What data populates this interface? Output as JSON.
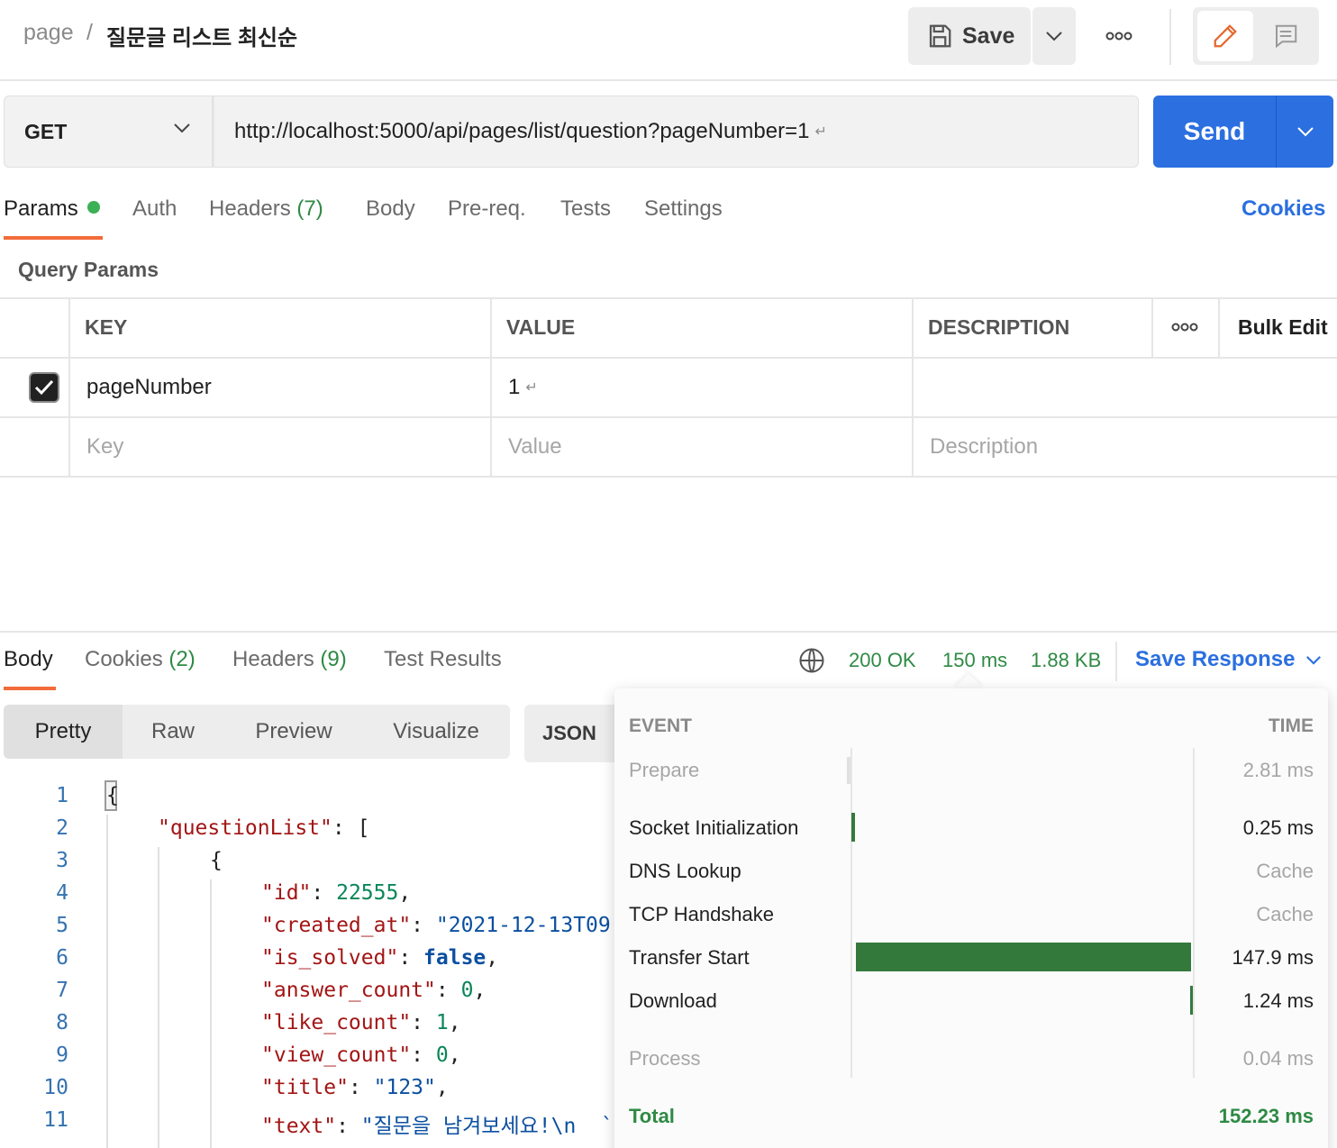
{
  "header": {
    "breadcrumb_root": "page",
    "breadcrumb_sep": "/",
    "title": "질문글 리스트 최신순",
    "save_label": "Save"
  },
  "request": {
    "method": "GET",
    "url": "http://localhost:5000/api/pages/list/question?pageNumber=1",
    "send_label": "Send",
    "return_glyph": "↵"
  },
  "request_tabs": {
    "params": "Params",
    "auth": "Auth",
    "headers": "Headers",
    "headers_count": "(7)",
    "body": "Body",
    "prereq": "Pre-req.",
    "tests": "Tests",
    "settings": "Settings",
    "cookies": "Cookies"
  },
  "query_params": {
    "title": "Query Params",
    "columns": {
      "key": "KEY",
      "value": "VALUE",
      "description": "DESCRIPTION",
      "bulk_edit": "Bulk Edit"
    },
    "rows": [
      {
        "key": "pageNumber",
        "value": "1",
        "checked": true
      }
    ],
    "placeholders": {
      "key": "Key",
      "value": "Value",
      "description": "Description"
    }
  },
  "response_tabs": {
    "body": "Body",
    "cookies": "Cookies",
    "cookies_count": "(2)",
    "headers": "Headers",
    "headers_count": "(9)",
    "test_results": "Test Results"
  },
  "response_status": {
    "status": "200 OK",
    "time": "150 ms",
    "size": "1.88 KB",
    "save_response": "Save Response"
  },
  "view_modes": {
    "pretty": "Pretty",
    "raw": "Raw",
    "preview": "Preview",
    "visualize": "Visualize",
    "format": "JSON"
  },
  "code_lines": [
    {
      "n": "1"
    },
    {
      "n": "2"
    },
    {
      "n": "3"
    },
    {
      "n": "4"
    },
    {
      "n": "5"
    },
    {
      "n": "6"
    },
    {
      "n": "7"
    },
    {
      "n": "8"
    },
    {
      "n": "9"
    },
    {
      "n": "10"
    },
    {
      "n": "11"
    }
  ],
  "code": {
    "l1": "{",
    "l2_key": "\"questionList\"",
    "l2_rest": ": [",
    "l3": "{",
    "l4_key": "\"id\"",
    "l4_val": "22555",
    "l5_key": "\"created_at\"",
    "l5_val": "\"2021-12-13T09",
    "l6_key": "\"is_solved\"",
    "l6_val": "false",
    "l7_key": "\"answer_count\"",
    "l7_val": "0",
    "l8_key": "\"like_count\"",
    "l8_val": "1",
    "l9_key": "\"view_count\"",
    "l9_val": "0",
    "l10_key": "\"title\"",
    "l10_val": "\"123\"",
    "l11_key": "\"text\"",
    "l11_val": "\"질문을 남겨보세요!\\n  `"
  },
  "timing": {
    "event_header": "EVENT",
    "time_header": "TIME",
    "events": [
      {
        "name": "Prepare",
        "time": "2.81 ms"
      },
      {
        "name": "Socket Initialization",
        "time": "0.25 ms"
      },
      {
        "name": "DNS Lookup",
        "time": "Cache"
      },
      {
        "name": "TCP Handshake",
        "time": "Cache"
      },
      {
        "name": "Transfer Start",
        "time": "147.9 ms"
      },
      {
        "name": "Download",
        "time": "1.24 ms"
      },
      {
        "name": "Process",
        "time": "0.04 ms"
      }
    ],
    "total_label": "Total",
    "total_time": "152.23 ms",
    "bar_color": "#34793c"
  },
  "colors": {
    "accent": "#2b6fe0",
    "tab_underline": "#f26b3a",
    "status_green": "#2e8a44"
  }
}
